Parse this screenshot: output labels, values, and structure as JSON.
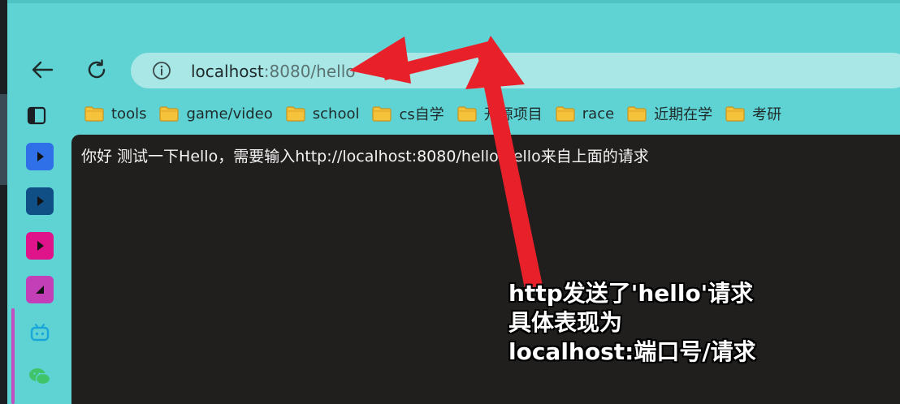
{
  "browser": {
    "address": {
      "host": "localhost",
      "rest": ":8080/hello"
    }
  },
  "bookmarks": [
    {
      "label": "tools"
    },
    {
      "label": "game/video"
    },
    {
      "label": "school"
    },
    {
      "label": "cs自学"
    },
    {
      "label": "开源项目"
    },
    {
      "label": "race"
    },
    {
      "label": "近期在学"
    },
    {
      "label": "考研"
    }
  ],
  "page": {
    "body_text": "你好 测试一下Hello，需要输入http://localhost:8080/hello,hello来自上面的请求"
  },
  "annotation": {
    "lines": [
      "http发送了'hello'请求",
      "具体表现为",
      "localhost:端口号/请求"
    ]
  },
  "colors": {
    "browser_chrome": "#5fd3d3",
    "address_bar": "#a9e6e6",
    "page_background": "#211f1e",
    "arrow": "#e8202a",
    "sidebar_accent": "#c24ebf"
  },
  "sidebar_apps": [
    {
      "icon": "play-app-icon-blue",
      "color": "#2f6fe8"
    },
    {
      "icon": "play-app-icon-dark-blue",
      "color": "#0f4f86"
    },
    {
      "icon": "play-app-icon-magenta",
      "color": "#e0148a"
    },
    {
      "icon": "wedge-app-icon-purple",
      "color": "#c23fb8"
    },
    {
      "icon": "bilibili-icon",
      "color": "#18a6d8"
    },
    {
      "icon": "wechat-icon",
      "color": "#3fc46a"
    }
  ]
}
